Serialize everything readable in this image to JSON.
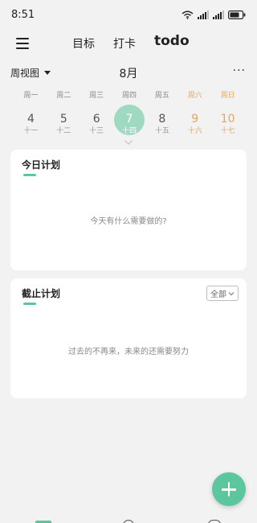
{
  "status_bar": {
    "time": "8:51",
    "icons": [
      "wifi-icon",
      "signal-icon",
      "signal-icon",
      "battery-icon"
    ]
  },
  "nav": {
    "menu_icon": "hamburger-menu-icon",
    "tabs": [
      {
        "label": "目标",
        "active": false
      },
      {
        "label": "打卡",
        "active": false
      },
      {
        "label": "todo",
        "active": true
      }
    ]
  },
  "calendar": {
    "view_label": "周视图",
    "month": "8月",
    "more_label": "···",
    "weekdays": [
      "周一",
      "周二",
      "周三",
      "周四",
      "周五",
      "周六",
      "周日"
    ],
    "dates": [
      {
        "day": "4",
        "lunar": "十一",
        "weekend": false,
        "selected": false
      },
      {
        "day": "5",
        "lunar": "十二",
        "weekend": false,
        "selected": false
      },
      {
        "day": "6",
        "lunar": "十三",
        "weekend": false,
        "selected": false
      },
      {
        "day": "7",
        "lunar": "十四",
        "weekend": false,
        "selected": true
      },
      {
        "day": "8",
        "lunar": "十五",
        "weekend": false,
        "selected": false
      },
      {
        "day": "9",
        "lunar": "十六",
        "weekend": true,
        "selected": false
      },
      {
        "day": "10",
        "lunar": "十七",
        "weekend": true,
        "selected": false
      }
    ]
  },
  "today_plan": {
    "title": "今日计划",
    "empty_text": "今天有什么需要做的?"
  },
  "deadline_plan": {
    "title": "截止计划",
    "filter_label": "全部",
    "empty_text": "过去的不再来，未来的还需要努力"
  },
  "fab": {
    "icon": "plus-icon"
  },
  "colors": {
    "accent": "#5cc79e",
    "selected_day": "#9fd9c2",
    "weekend": "#e8a45a",
    "background": "#f2f2f2"
  }
}
